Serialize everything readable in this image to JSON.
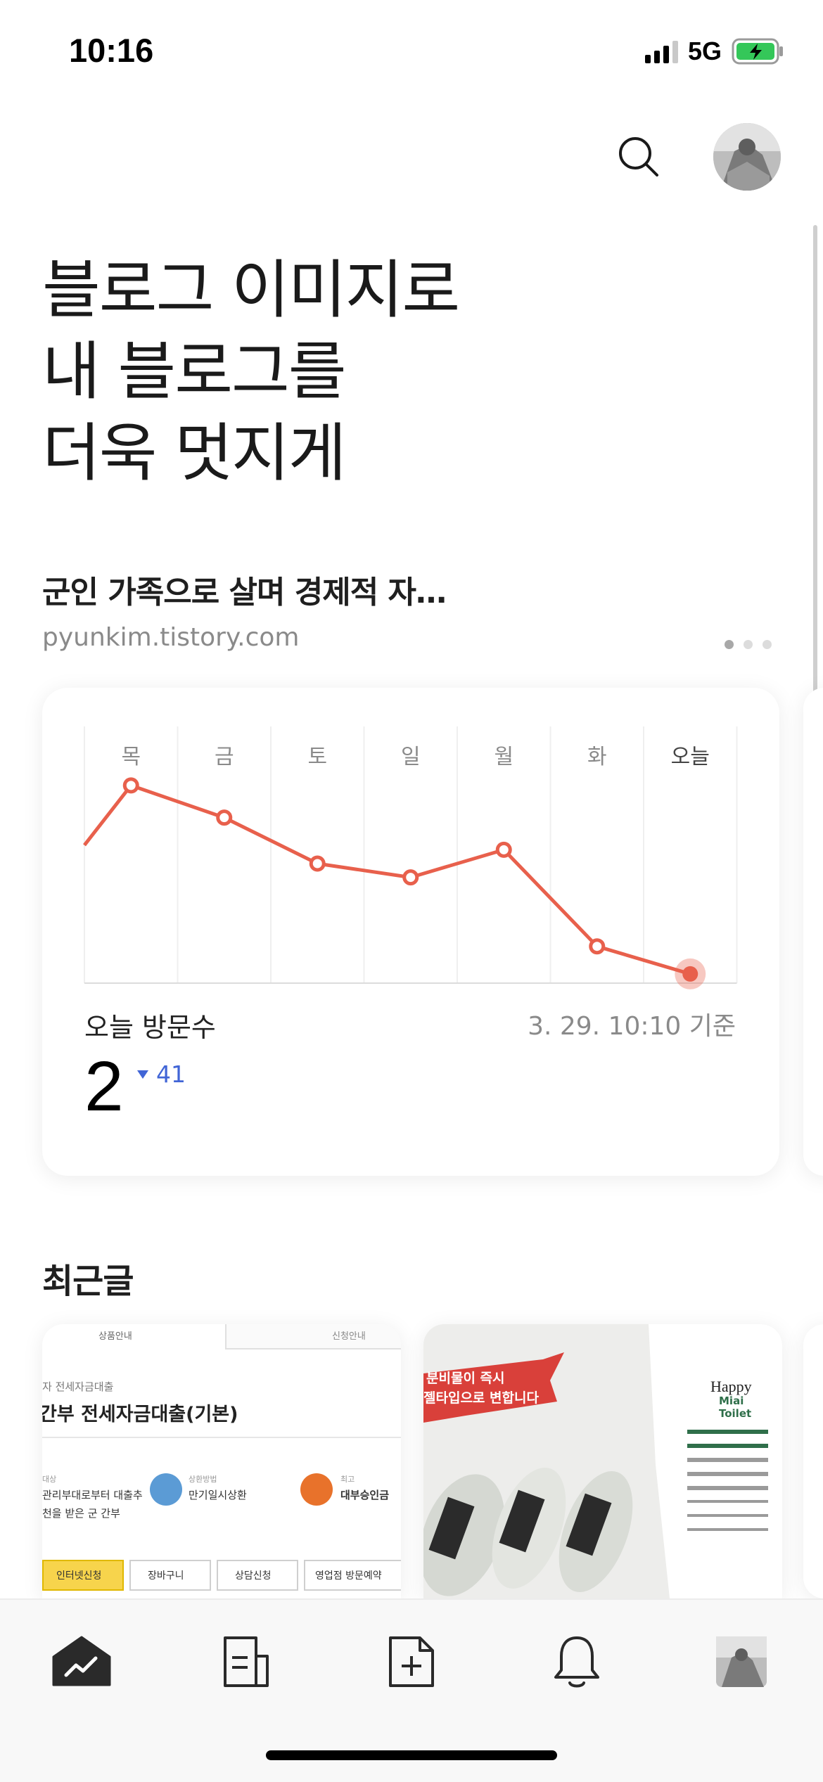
{
  "status_bar": {
    "time": "10:16",
    "network": "5G",
    "battery_icon": "battery-charging-icon",
    "battery_color": "#34c759"
  },
  "header": {
    "search_icon": "search-icon",
    "avatar_icon": "profile-avatar"
  },
  "hero": {
    "line1": "블로그 이미지로",
    "line2": "내 블로그를",
    "line3": "더욱 멋지게"
  },
  "blog": {
    "title": "군인 가족으로 살며 경제적 자…",
    "url": "pyunkim.tistory.com",
    "carousel_total": 3,
    "carousel_active": 1
  },
  "stats_card": {
    "visit_label": "오늘 방문수",
    "visit_count": "2",
    "delta": "41",
    "delta_direction": "down",
    "delta_color": "#4165d6",
    "timestamp": "3. 29. 10:10 기준"
  },
  "chart_data": {
    "type": "line",
    "categories": [
      "목",
      "금",
      "토",
      "일",
      "월",
      "화",
      "오늘"
    ],
    "series": [
      {
        "values": [
          43,
          36,
          26,
          23,
          29,
          8,
          2
        ],
        "color": "#e8604c"
      }
    ],
    "leading_value": 30,
    "ylim": [
      0,
      52
    ],
    "grid": true,
    "highlight_last": true
  },
  "recent": {
    "title": "최근글",
    "thumb1": {
      "tab_left": "상품안내",
      "tab_right": "신청안내",
      "category": "자 전세자금대출",
      "heading": "간부 전세자금대출(기본)",
      "info1_label": "대상",
      "info1_value": "관리부대로부터 대출추",
      "info1_value2": "천을 받은 군 간부",
      "info2_label": "상환방법",
      "info2_value": "만기일시상환",
      "info3_label": "최고",
      "info3_value": "대부승인금",
      "btn1": "인터넷신청",
      "btn2": "장바구니",
      "btn3": "상담신청",
      "btn4": "영업점 방문예약"
    },
    "thumb2": {
      "banner_line1": "분비물이 즉시",
      "banner_line2": "젤타입으로 변합니다",
      "brand_line1": "Happy",
      "brand_line2": "Miai",
      "brand_line3": "Toilet"
    }
  },
  "tab_bar": {
    "tabs": [
      "stats-icon",
      "posts-icon",
      "write-icon",
      "bell-icon",
      "profile-avatar"
    ],
    "active": "stats-icon"
  }
}
